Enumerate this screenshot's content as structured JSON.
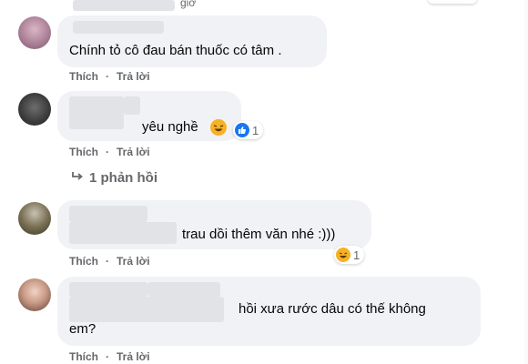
{
  "colors": {
    "bubble": "#f0f2f5",
    "action_text": "#65676b",
    "like_blue": "#1877f2",
    "haha_yellow": "#f7b125"
  },
  "top": {
    "timestamp_fragment": "giờ"
  },
  "comments": [
    {
      "text": "Chính tỏ cô đau bán thuốc có tâm .",
      "like_label": "Thích",
      "reply_label": "Trả lời"
    },
    {
      "text": "yêu nghề",
      "like_label": "Thích",
      "reply_label": "Trả lời",
      "reaction_count": "1",
      "reaction_icons": [
        "haha-icon",
        "like-icon"
      ]
    },
    {
      "text": "trau dồi thêm văn nhé :)))",
      "like_label": "Thích",
      "reply_label": "Trả lời",
      "reaction_count": "1",
      "reaction_icons": [
        "haha-icon"
      ]
    },
    {
      "text_line1": "hồi xưa rước dâu có thế không",
      "text_line2": "em?",
      "like_label": "Thích",
      "reply_label": "Trả lời"
    }
  ],
  "replies_link": {
    "label": "1 phản hồi"
  }
}
